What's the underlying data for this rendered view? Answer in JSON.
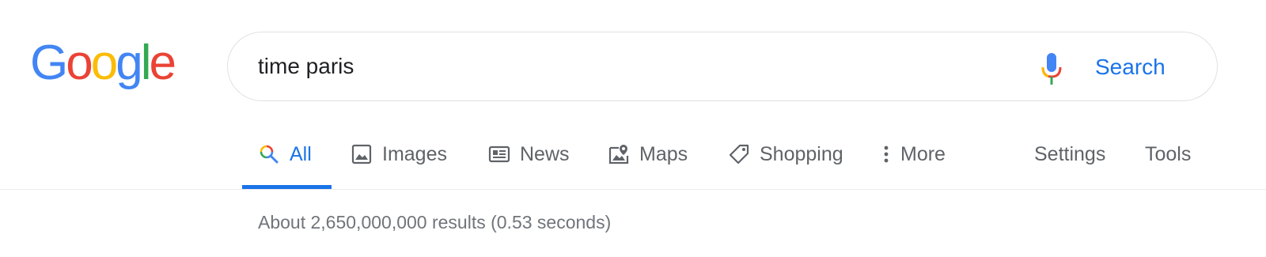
{
  "logo": {
    "letters": [
      "G",
      "o",
      "o",
      "g",
      "l",
      "e"
    ],
    "colors": [
      "#4285f4",
      "#ea4335",
      "#fbbc05",
      "#4285f4",
      "#34a853",
      "#ea4335"
    ]
  },
  "search": {
    "query": "time paris",
    "button_label": "Search",
    "mic_icon": "microphone-icon"
  },
  "tabs": [
    {
      "label": "All",
      "icon": "search-icon",
      "active": true
    },
    {
      "label": "Images",
      "icon": "image-icon",
      "active": false
    },
    {
      "label": "News",
      "icon": "news-icon",
      "active": false
    },
    {
      "label": "Maps",
      "icon": "map-icon",
      "active": false
    },
    {
      "label": "Shopping",
      "icon": "tag-icon",
      "active": false
    },
    {
      "label": "More",
      "icon": "more-vert-icon",
      "active": false
    }
  ],
  "tools": {
    "settings_label": "Settings",
    "tools_label": "Tools"
  },
  "results": {
    "stats": "About 2,650,000,000 results (0.53 seconds)"
  },
  "colors": {
    "accent": "#1a73e8",
    "text_secondary": "#5f6368",
    "stats": "#70757a",
    "border": "#dfe1e5"
  }
}
